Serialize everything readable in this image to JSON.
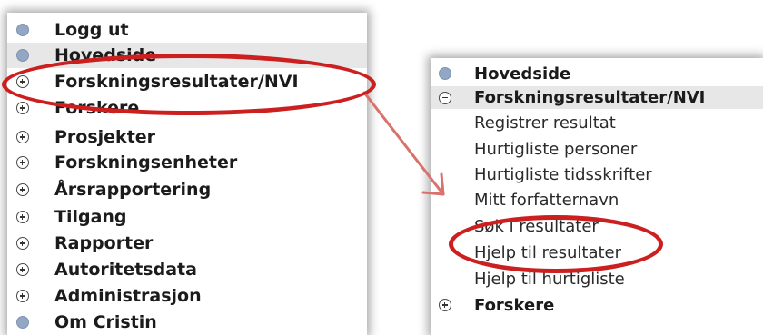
{
  "left_menu": {
    "items": [
      {
        "label": "Logg ut",
        "icon": "dot-icon"
      },
      {
        "label": "Hovedside",
        "icon": "dot-icon",
        "highlighted": true
      },
      {
        "label": "Forskningsresultater/NVI",
        "icon": "plus-icon",
        "circled": true
      },
      {
        "label": "Forskere",
        "icon": "plus-icon"
      },
      {
        "label": "Prosjekter",
        "icon": "plus-icon"
      },
      {
        "label": "Forskningsenheter",
        "icon": "plus-icon"
      },
      {
        "label": "Årsrapportering",
        "icon": "plus-icon"
      },
      {
        "label": "Tilgang",
        "icon": "plus-icon"
      },
      {
        "label": "Rapporter",
        "icon": "plus-icon"
      },
      {
        "label": "Autoritetsdata",
        "icon": "plus-icon"
      },
      {
        "label": "Administrasjon",
        "icon": "plus-icon"
      },
      {
        "label": "Om Cristin",
        "icon": "dot-icon"
      }
    ]
  },
  "right_menu": {
    "items": [
      {
        "label": "Hovedside",
        "icon": "dot-icon"
      },
      {
        "label": "Forskningsresultater/NVI",
        "icon": "minus-icon",
        "highlighted": true
      },
      {
        "label": "Registrer resultat"
      },
      {
        "label": "Hurtigliste personer"
      },
      {
        "label": "Hurtigliste tidsskrifter"
      },
      {
        "label": "Mitt forfatternavn"
      },
      {
        "label": "Søk i resultater",
        "circled": true
      },
      {
        "label": "Hjelp til resultater"
      },
      {
        "label": "Hjelp til hurtigliste"
      },
      {
        "label": "Forskere",
        "icon": "plus-icon"
      }
    ]
  },
  "annotation_color": "#cc1f1f",
  "arrow_color": "#d9726c"
}
